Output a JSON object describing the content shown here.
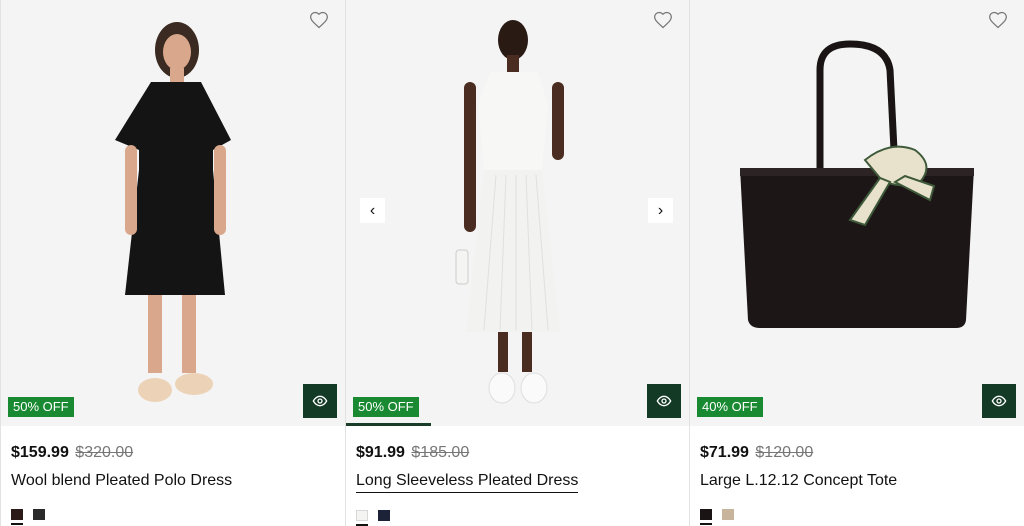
{
  "products": [
    {
      "name": "Wool blend Pleated Polo Dress",
      "price_now": "$159.99",
      "price_was": "$320.00",
      "badge": "50% OFF",
      "swatches": [
        "#2b1a17",
        "#2a2a2a"
      ]
    },
    {
      "name": "Long Sleeveless Pleated Dress",
      "price_now": "$91.99",
      "price_was": "$185.00",
      "badge": "50% OFF",
      "swatches": [
        "#f4f4f2",
        "#1c2338"
      ]
    },
    {
      "name": "Large L.12.12 Concept Tote",
      "price_now": "$71.99",
      "price_was": "$120.00",
      "badge": "40% OFF",
      "swatches": [
        "#1a1414",
        "#c8b49a"
      ]
    }
  ],
  "icons": {
    "wishlist": "heart-icon",
    "quickview": "eye-icon",
    "prev": "chevron-left-icon",
    "next": "chevron-right-icon",
    "prev_glyph": "‹",
    "next_glyph": "›"
  },
  "colors": {
    "badge": "#1a8a32",
    "quickview": "#133a24"
  }
}
